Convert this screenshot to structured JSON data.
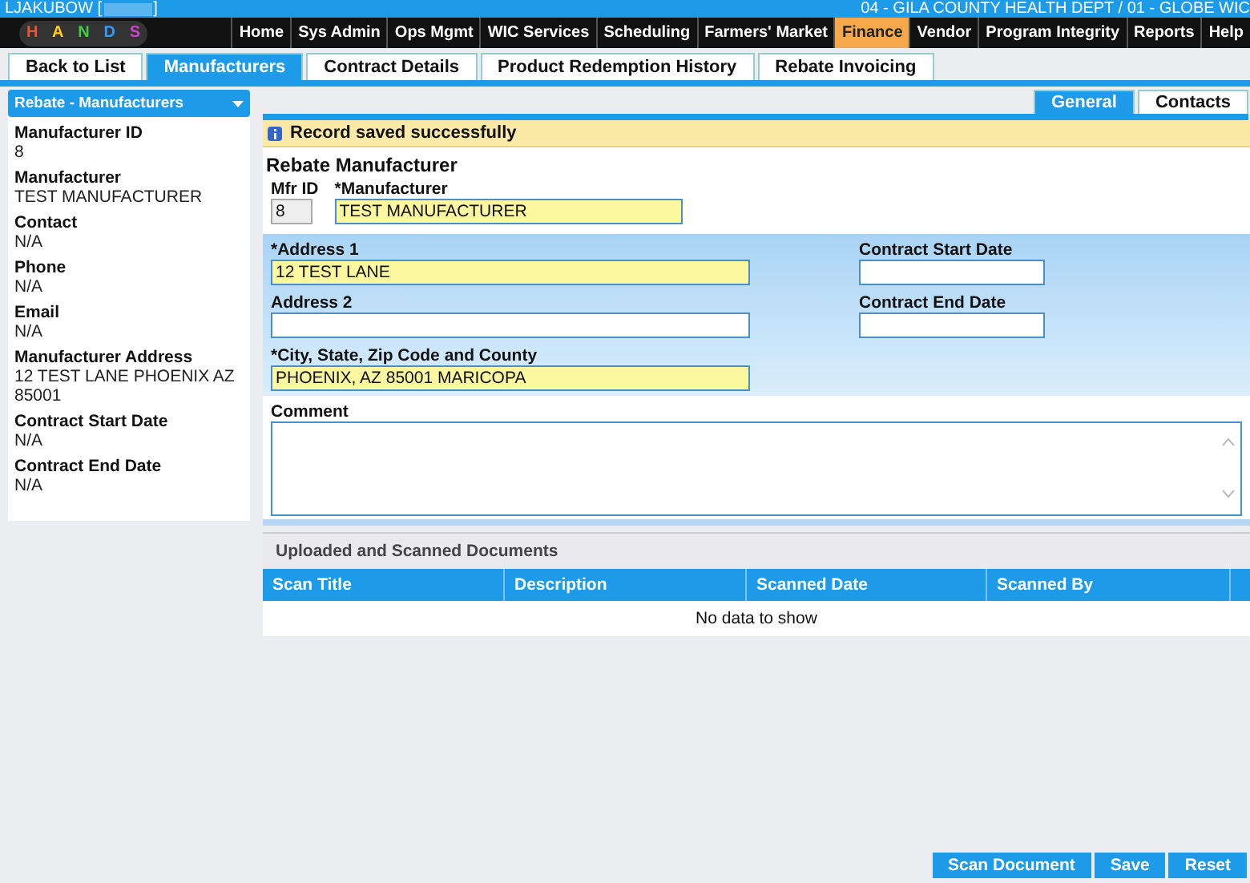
{
  "header": {
    "user": "LJAKUBOW [",
    "user_end": "]",
    "location": "04 - GILA COUNTY HEALTH DEPT / 01 - GLOBE WIC"
  },
  "logo": {
    "letters": [
      "H",
      "A",
      "N",
      "D",
      "S"
    ]
  },
  "menu": [
    {
      "label": "Home",
      "selected": false
    },
    {
      "label": "Sys Admin",
      "selected": false
    },
    {
      "label": "Ops Mgmt",
      "selected": false
    },
    {
      "label": "WIC Services",
      "selected": false
    },
    {
      "label": "Scheduling",
      "selected": false
    },
    {
      "label": "Farmers' Market",
      "selected": false
    },
    {
      "label": "Finance",
      "selected": true
    },
    {
      "label": "Vendor",
      "selected": false
    },
    {
      "label": "Program Integrity",
      "selected": false
    },
    {
      "label": "Reports",
      "selected": false
    },
    {
      "label": "Help",
      "selected": false
    }
  ],
  "tabs": [
    {
      "label": "Back to List",
      "selected": false
    },
    {
      "label": "Manufacturers",
      "selected": true
    },
    {
      "label": "Contract Details",
      "selected": false
    },
    {
      "label": "Product Redemption History",
      "selected": false
    },
    {
      "label": "Rebate Invoicing",
      "selected": false
    }
  ],
  "sidebar": {
    "title": "Rebate - Manufacturers",
    "items": [
      {
        "label": "Manufacturer ID",
        "value": "8"
      },
      {
        "label": "Manufacturer",
        "value": "TEST MANUFACTURER"
      },
      {
        "label": "Contact",
        "value": "N/A"
      },
      {
        "label": "Phone",
        "value": "N/A"
      },
      {
        "label": "Email",
        "value": "N/A"
      },
      {
        "label": "Manufacturer Address",
        "value": "12 TEST LANE PHOENIX AZ 85001"
      },
      {
        "label": "Contract Start Date",
        "value": "N/A"
      },
      {
        "label": "Contract End Date",
        "value": "N/A"
      }
    ]
  },
  "subtabs": [
    {
      "label": "General",
      "selected": true
    },
    {
      "label": "Contacts",
      "selected": false
    }
  ],
  "message": "Record saved successfully",
  "form": {
    "title": "Rebate Manufacturer",
    "mfr_id": {
      "label": "Mfr ID",
      "value": "8"
    },
    "manufacturer": {
      "label": "*Manufacturer",
      "value": "TEST MANUFACTURER"
    },
    "address1": {
      "label": "*Address 1",
      "value": "12 TEST LANE"
    },
    "address2": {
      "label": "Address 2"
    },
    "city": {
      "label": "*City, State, Zip Code and County",
      "value": "PHOENIX, AZ 85001 MARICOPA"
    },
    "start": {
      "label": "Contract Start Date"
    },
    "end": {
      "label": "Contract End Date"
    },
    "comment": {
      "label": "Comment"
    }
  },
  "documents": {
    "title": "Uploaded and Scanned Documents",
    "columns": [
      "Scan Title",
      "Description",
      "Scanned Date",
      "Scanned By"
    ],
    "empty": "No data to show"
  },
  "buttons": [
    "Scan Document",
    "Save",
    "Reset"
  ]
}
